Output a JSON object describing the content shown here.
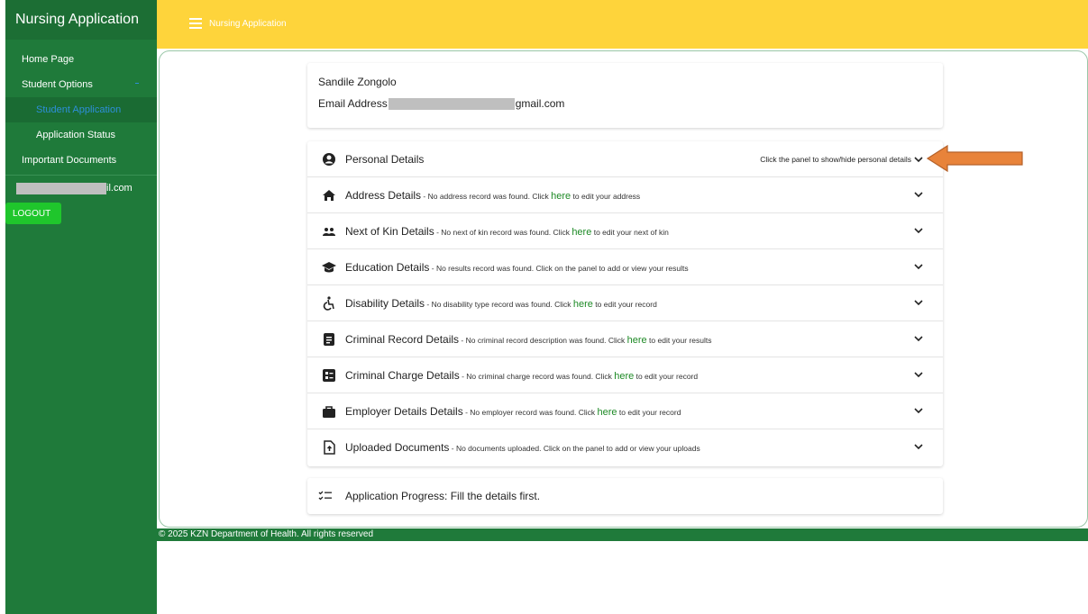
{
  "sidebar": {
    "brand": "Nursing Application",
    "items": [
      {
        "label": "Home Page"
      },
      {
        "label": "Student Options"
      },
      {
        "label": "Student Application"
      },
      {
        "label": "Application Status"
      },
      {
        "label": "Important Documents"
      }
    ],
    "email_suffix": "il.com",
    "logout": "LOGOUT"
  },
  "topbar": {
    "title": "Nursing Application"
  },
  "user": {
    "name": "Sandile Zongolo",
    "email_label": "Email Address",
    "email_suffix": "gmail.com"
  },
  "panels": [
    {
      "icon": "user-circle-icon",
      "title": "Personal Details",
      "hint": "Click the panel to show/hide personal details"
    },
    {
      "icon": "home-icon",
      "title": "Address Details",
      "desc_pre": " - No address record was found. Click ",
      "link": "here",
      "desc_post": " to edit your address"
    },
    {
      "icon": "people-icon",
      "title": "Next of Kin Details",
      "desc_pre": " - No next of kin record was found. Click ",
      "link": "here",
      "desc_post": " to edit your next of kin"
    },
    {
      "icon": "graduation-cap-icon",
      "title": "Education Details",
      "desc_pre": " - No results record was found. Click on the panel to add or view your results",
      "link": "",
      "desc_post": ""
    },
    {
      "icon": "wheelchair-icon",
      "title": "Disability Details",
      "desc_pre": " - No disability type record was found. Click ",
      "link": "here",
      "desc_post": " to edit your record"
    },
    {
      "icon": "document-icon",
      "title": "Criminal Record Details",
      "desc_pre": " - No criminal record description was found. Click ",
      "link": "here",
      "desc_post": " to edit your results"
    },
    {
      "icon": "list-icon",
      "title": "Criminal Charge Details",
      "desc_pre": " - No criminal charge record was found. Click ",
      "link": "here",
      "desc_post": " to edit your record"
    },
    {
      "icon": "briefcase-icon",
      "title": "Employer Details Details",
      "desc_pre": " - No employer record was found. Click ",
      "link": "here",
      "desc_post": " to edit your record"
    },
    {
      "icon": "upload-file-icon",
      "title": "Uploaded Documents",
      "desc_pre": " - No documents uploaded. Click on the panel to add or view your uploads",
      "link": "",
      "desc_post": ""
    }
  ],
  "progress": {
    "label": "Application Progress: Fill the details first."
  },
  "footer": "© 2025 KZN Department of Health. All rights reserved",
  "colors": {
    "sidebar": "#1f7a3a",
    "topbar": "#fed43b",
    "logout": "#1fc62c",
    "link": "#1e8a26",
    "arrow": "#e8833a"
  }
}
